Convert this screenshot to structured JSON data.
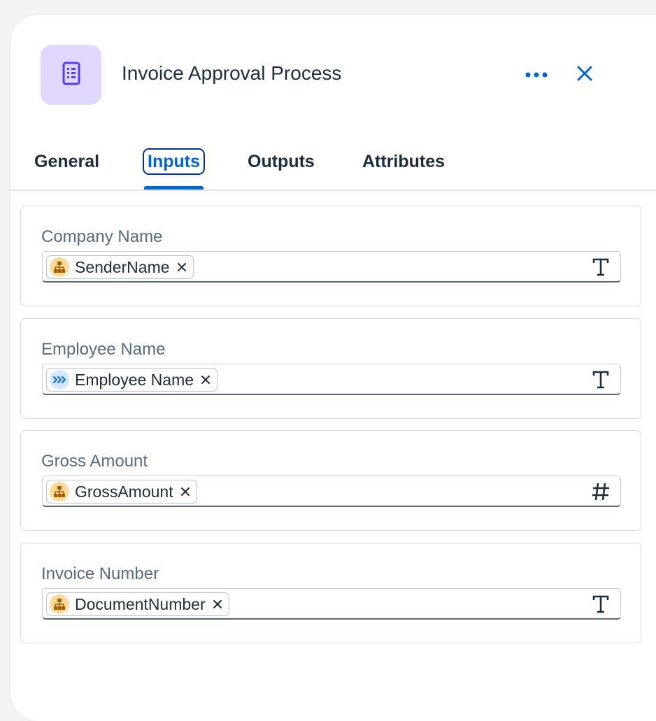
{
  "header": {
    "title": "Invoice Approval Process",
    "icon": "form-document-icon",
    "icon_tile_color": "#e2d8ff",
    "icon_color": "#5d36ff"
  },
  "tabs": [
    {
      "label": "General",
      "selected": false
    },
    {
      "label": "Inputs",
      "selected": true
    },
    {
      "label": "Outputs",
      "selected": false
    },
    {
      "label": "Attributes",
      "selected": false
    }
  ],
  "accent_color": "#0064d9",
  "fields": [
    {
      "label": "Company Name",
      "token": "SenderName",
      "token_icon": "hierarchy-icon",
      "type_icon": "text-type-icon"
    },
    {
      "label": "Employee Name",
      "token": "Employee Name",
      "token_icon": "process-chevrons-icon",
      "type_icon": "text-type-icon"
    },
    {
      "label": "Gross Amount",
      "token": "GrossAmount",
      "token_icon": "hierarchy-icon",
      "type_icon": "number-type-icon"
    },
    {
      "label": "Invoice Number",
      "token": "DocumentNumber",
      "token_icon": "hierarchy-icon",
      "type_icon": "text-type-icon"
    }
  ]
}
